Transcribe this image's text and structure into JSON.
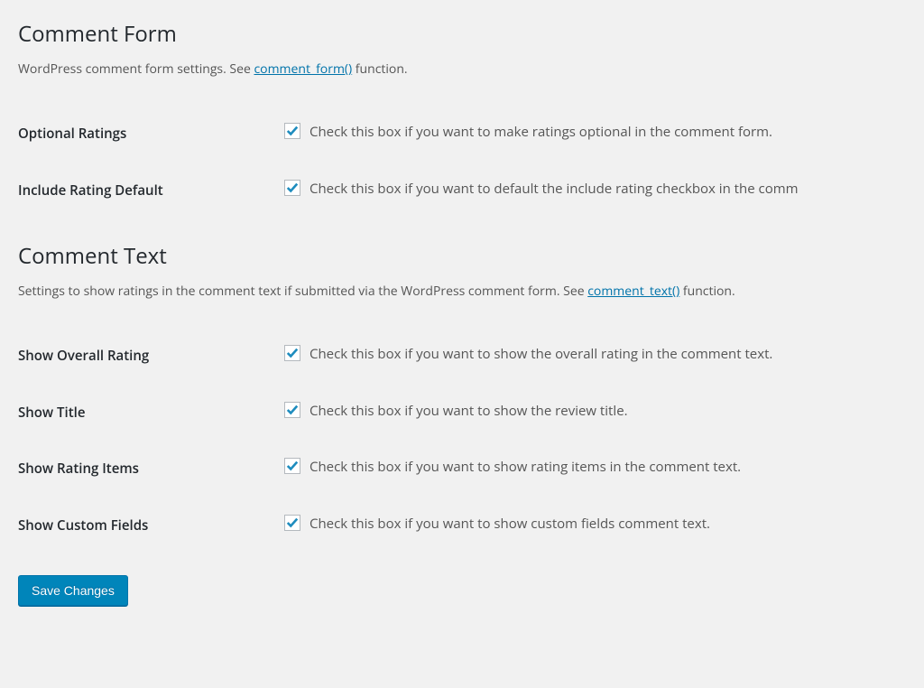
{
  "section1": {
    "title": "Comment Form",
    "desc_before": "WordPress comment form settings. See ",
    "desc_link": "comment_form()",
    "desc_after": " function.",
    "rows": [
      {
        "label": "Optional Ratings",
        "checked": true,
        "desc": "Check this box if you want to make ratings optional in the comment form."
      },
      {
        "label": "Include Rating Default",
        "checked": true,
        "desc": "Check this box if you want to default the include rating checkbox in the comm"
      }
    ]
  },
  "section2": {
    "title": "Comment Text",
    "desc_before": "Settings to show ratings in the comment text if submitted via the WordPress comment form. See ",
    "desc_link": "comment_text()",
    "desc_after": " function.",
    "rows": [
      {
        "label": "Show Overall Rating",
        "checked": true,
        "desc": "Check this box if you want to show the overall rating in the comment text."
      },
      {
        "label": "Show Title",
        "checked": true,
        "desc": "Check this box if you want to show the review title."
      },
      {
        "label": "Show Rating Items",
        "checked": true,
        "desc": "Check this box if you want to show rating items in the comment text."
      },
      {
        "label": "Show Custom Fields",
        "checked": true,
        "desc": "Check this box if you want to show custom fields comment text."
      }
    ]
  },
  "submit": {
    "label": "Save Changes"
  }
}
